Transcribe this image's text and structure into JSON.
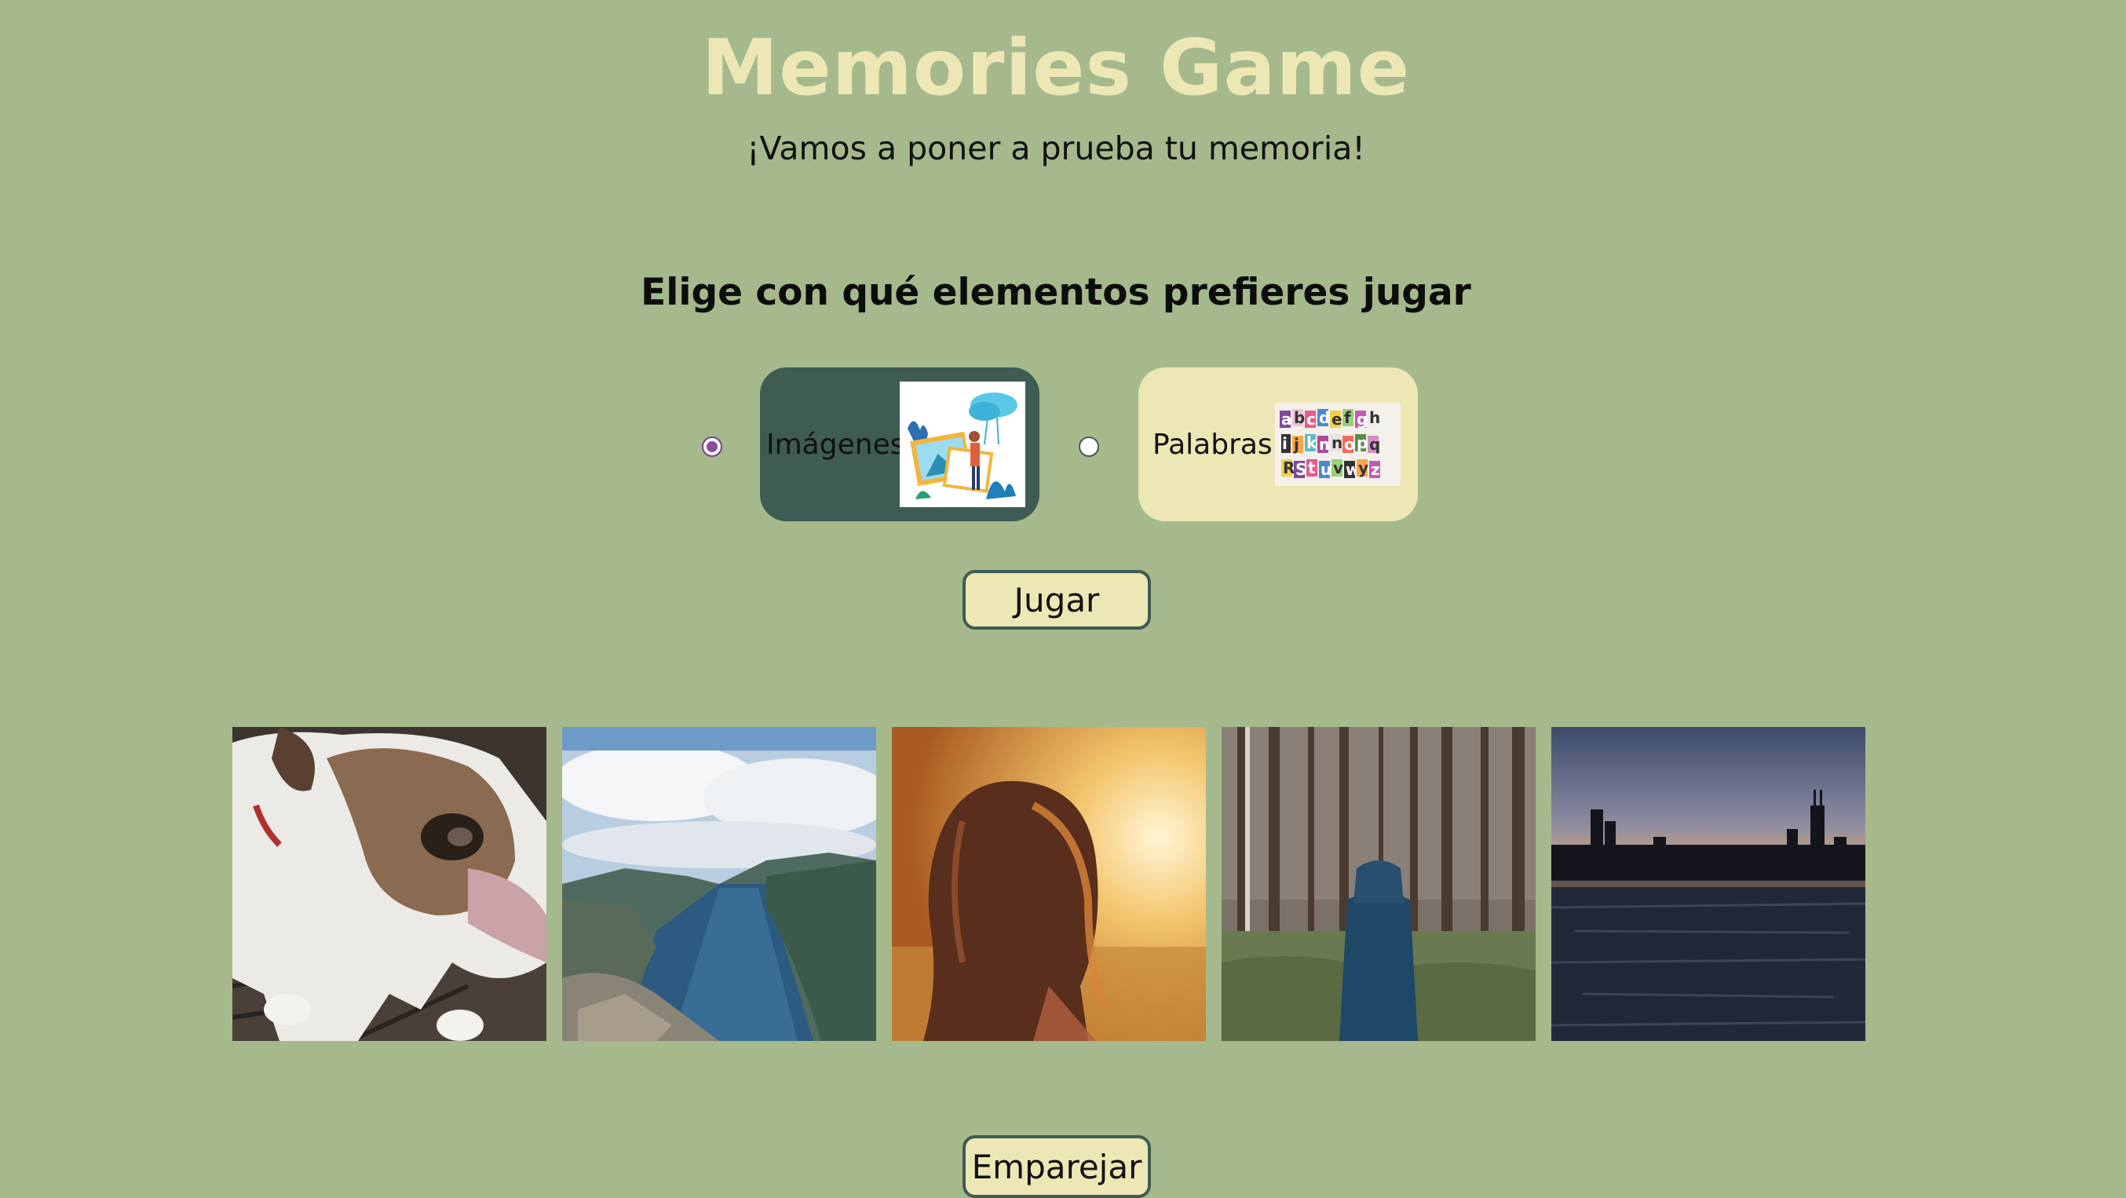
{
  "header": {
    "title": "Memories Game",
    "subtitle": "¡Vamos a poner a prueba tu memoria!"
  },
  "chooser": {
    "prompt": "Elige con qué elementos prefieres jugar",
    "options": [
      {
        "label": "Imágenes",
        "selected": true,
        "thumb_icon": "illustration-photos-icon"
      },
      {
        "label": "Palabras",
        "selected": false,
        "thumb_icon": "cutout-letters-icon"
      }
    ],
    "palabras_thumb_text": "abcdefgh ijklmnop rstuvwxyz"
  },
  "actions": {
    "play_label": "Jugar",
    "match_label": "Emparejar"
  },
  "cards": [
    {
      "name": "bulldog-photo"
    },
    {
      "name": "fjord-photo"
    },
    {
      "name": "girl-sunset-photo"
    },
    {
      "name": "forest-person-photo"
    },
    {
      "name": "city-skyline-photo"
    }
  ],
  "colors": {
    "background": "#a5b98c",
    "title": "#ece7b4",
    "selected_option": "#3e5c53",
    "unselected_option": "#ece7b4",
    "button_bg": "#ece7b4",
    "button_border": "#3e5c53",
    "radio_checked": "#8d4e9e"
  }
}
